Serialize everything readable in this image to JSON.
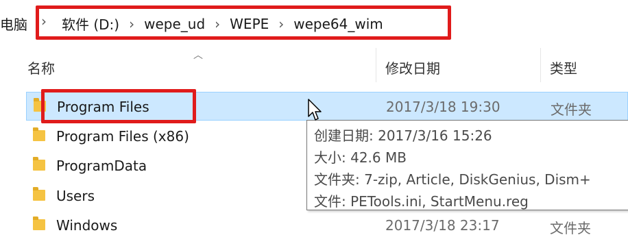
{
  "breadcrumb": {
    "root": "电脑",
    "items": [
      "软件 (D:)",
      "wepe_ud",
      "WEPE",
      "wepe64_wim"
    ]
  },
  "columns": {
    "name": "名称",
    "date_modified": "修改日期",
    "type": "类型"
  },
  "rows": [
    {
      "name": "Program Files",
      "date": "2017/3/18 19:30",
      "type": "文件夹"
    },
    {
      "name": "Program Files (x86)",
      "date": "",
      "type": ""
    },
    {
      "name": "ProgramData",
      "date": "",
      "type": ""
    },
    {
      "name": "Users",
      "date": "",
      "type": ""
    },
    {
      "name": "Windows",
      "date": "2017/3/18 23:17",
      "type": "文件夹"
    }
  ],
  "tooltip": {
    "created": "创建日期: 2017/3/16 15:26",
    "size": "大小: 42.6 MB",
    "folders": "文件夹: 7-zip, Article, DiskGenius, Dism+",
    "files": "文件: PETools.ini, StartMenu.reg"
  },
  "colors": {
    "highlight_red": "#e01b1b",
    "selection_bg": "#cce8ff",
    "selection_border": "#99d1ff",
    "folder_yellow": "#f5c342"
  },
  "icons": [
    "chevron-right-icon",
    "sort-up-icon",
    "folder-icon",
    "mouse-cursor-icon"
  ]
}
